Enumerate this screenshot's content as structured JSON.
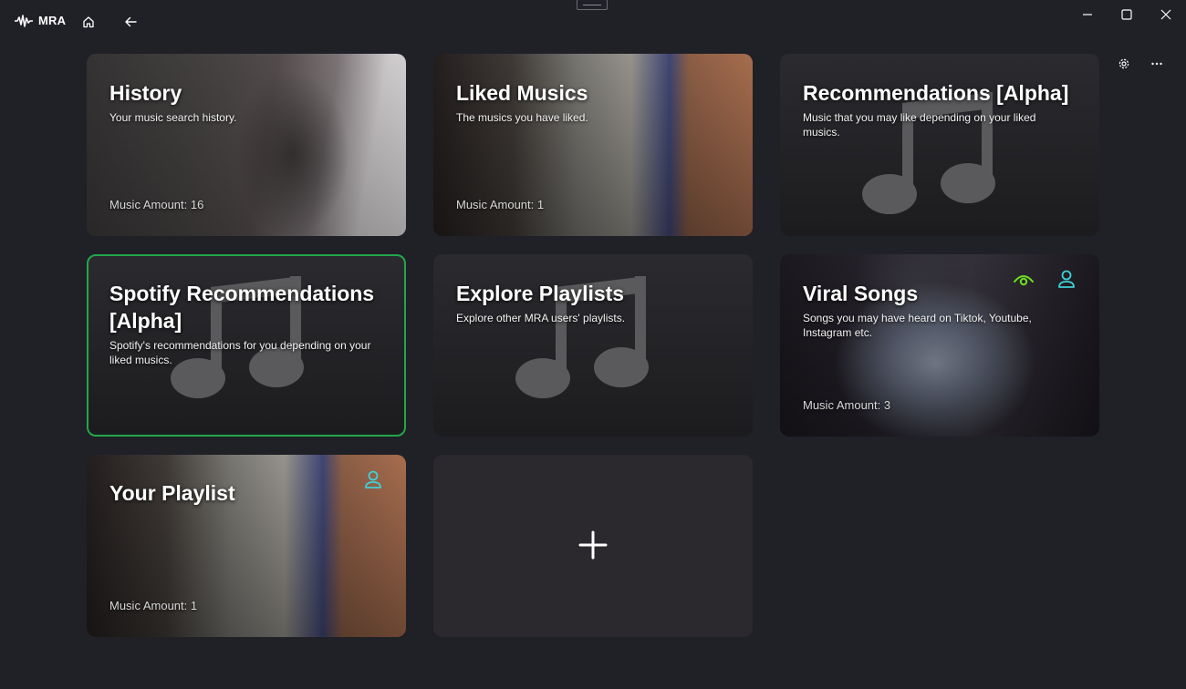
{
  "app": {
    "name": "MRA",
    "logo_icon": "soundwave-icon"
  },
  "titlebar": {
    "home_icon": "home-icon",
    "back_icon": "back-arrow-icon",
    "minimize_icon": "minimize-icon",
    "maximize_icon": "maximize-icon",
    "close_icon": "close-icon"
  },
  "toolbar": {
    "library_icon": "library-icon",
    "settings_icon": "gear-icon",
    "more_icon": "more-icon"
  },
  "colors": {
    "background": "#202027",
    "selected_border": "#22a74a",
    "public_badge": "#6ee022",
    "user_badge": "#3fd0d8"
  },
  "cards": {
    "history": {
      "title": "History",
      "description": "Your music search history.",
      "amount": "Music Amount: 16"
    },
    "liked": {
      "title": "Liked Musics",
      "description": "The musics you have liked.",
      "amount": "Music Amount: 1"
    },
    "recommendations": {
      "title": "Recommendations [Alpha]",
      "description": "Music that you may like depending on your liked musics."
    },
    "spotify": {
      "title": "Spotify Recommendations [Alpha]",
      "description": "Spotify's recommendations for you depending on your liked musics."
    },
    "explore": {
      "title": "Explore Playlists",
      "description": "Explore other MRA users' playlists."
    },
    "viral": {
      "title": "Viral Songs",
      "description": "Songs you may have heard on Tiktok, Youtube, Instagram etc.",
      "amount": "Music Amount: 3"
    },
    "your_playlist": {
      "title": "Your Playlist",
      "amount": "Music Amount: 1"
    },
    "add": {
      "icon": "plus-icon"
    }
  }
}
